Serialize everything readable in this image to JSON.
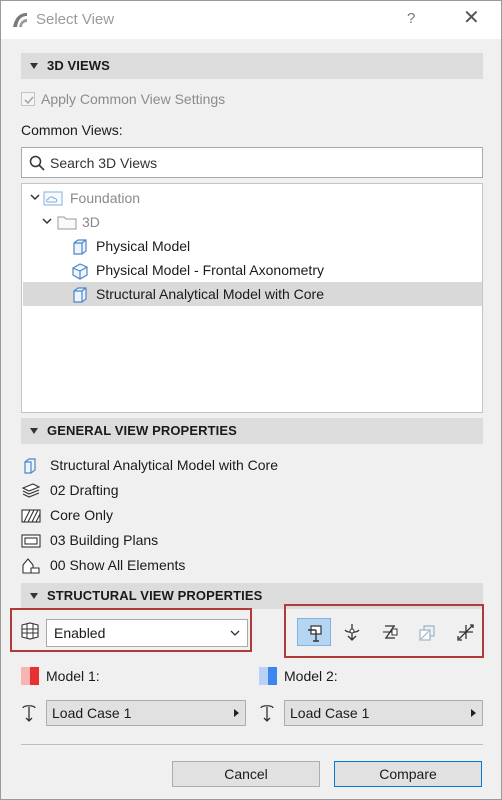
{
  "window": {
    "title": "Select View",
    "help": "?",
    "close": "✕"
  },
  "views3d": {
    "header": "3D VIEWS",
    "apply_common": "Apply Common View Settings",
    "common_label": "Common Views:",
    "search_placeholder": "Search 3D Views",
    "tree": {
      "root": "Foundation",
      "folder": "3D",
      "items": [
        "Physical Model",
        "Physical Model - Frontal Axonometry",
        "Structural Analytical Model with Core"
      ],
      "selected": "Structural Analytical Model with Core"
    }
  },
  "general": {
    "header": "GENERAL VIEW PROPERTIES",
    "rows": [
      {
        "icon": "view-icon",
        "text": "Structural Analytical Model with Core"
      },
      {
        "icon": "layers-icon",
        "text": "02 Drafting"
      },
      {
        "icon": "hatch-icon",
        "text": "Core Only"
      },
      {
        "icon": "plan-icon",
        "text": "03 Building Plans"
      },
      {
        "icon": "elements-icon",
        "text": "00 Show All Elements"
      }
    ]
  },
  "structural": {
    "header": "STRUCTURAL VIEW PROPERTIES",
    "mode": "Enabled",
    "tools": [
      "display-member-icon",
      "support-icon",
      "link-icon",
      "surface-icon",
      "axis-icon"
    ],
    "active_tool": "display-member-icon",
    "model1_label": "Model 1:",
    "model2_label": "Model 2:",
    "model1_color": "#e83030",
    "model2_color": "#3d86f0",
    "load_case1": "Load Case 1",
    "load_case2": "Load Case 1"
  },
  "buttons": {
    "cancel": "Cancel",
    "compare": "Compare"
  }
}
